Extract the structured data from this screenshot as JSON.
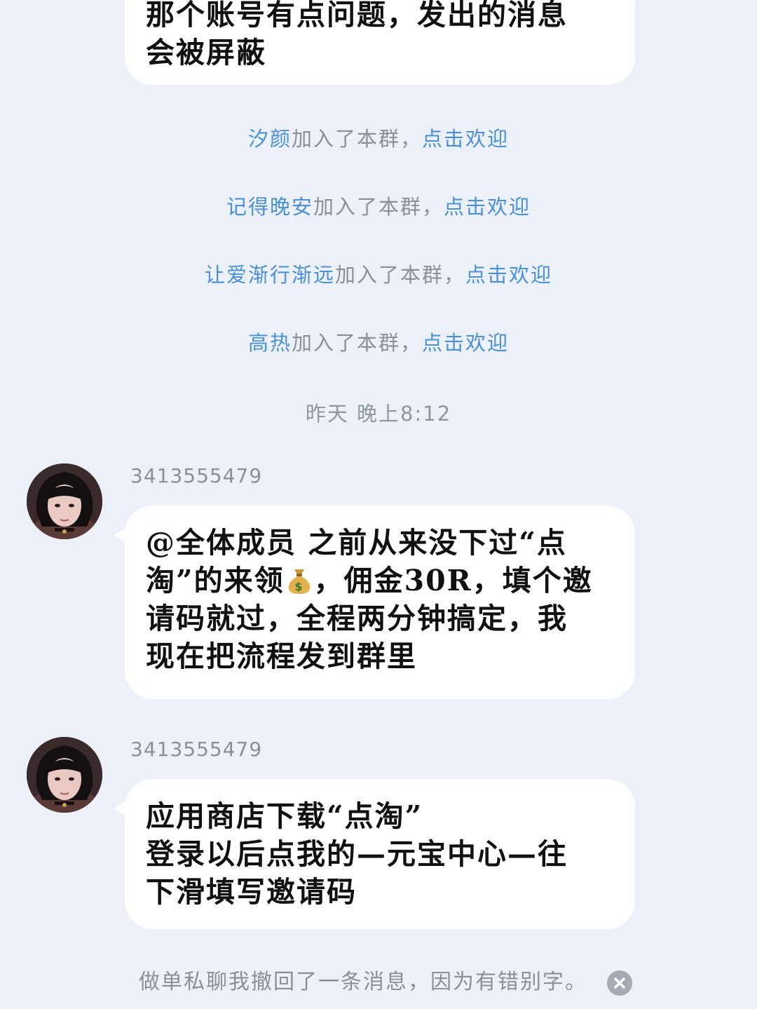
{
  "chat": {
    "top_message": {
      "text": "那个账号有点问题，发出的消息\n会被屏蔽"
    },
    "joins": [
      {
        "name": "汐颜",
        "text": "加入了本群，",
        "action": "点击欢迎"
      },
      {
        "name": "记得晚安",
        "text": "加入了本群，",
        "action": "点击欢迎"
      },
      {
        "name": "让爱渐行渐远",
        "text": "加入了本群，",
        "action": "点击欢迎"
      },
      {
        "name": "高热",
        "text": "加入了本群，",
        "action": "点击欢迎"
      }
    ],
    "timestamp": "昨天 晚上8:12",
    "messages": [
      {
        "sender": "3413555479",
        "text_part1": "@全体成员 之前从来没下过“点\n淘”的来领",
        "emoji": "money-bag-icon",
        "text_part2": "，佣金30R，填个邀\n请码就过，全程两分钟搞定，我\n现在把流程发到群里"
      },
      {
        "sender": "3413555479",
        "text": "应用商店下载“点淘”\n登录以后点我的—元宝中心—往\n下滑填写邀请码"
      }
    ],
    "recall_notice": "做单私聊我撤回了一条消息，因为有错别字。",
    "close_icon": "close-icon"
  },
  "colors": {
    "background": "#ecf0f8",
    "bubble": "#ffffff",
    "link": "#4a90d9",
    "system_text": "#8a8f99"
  }
}
